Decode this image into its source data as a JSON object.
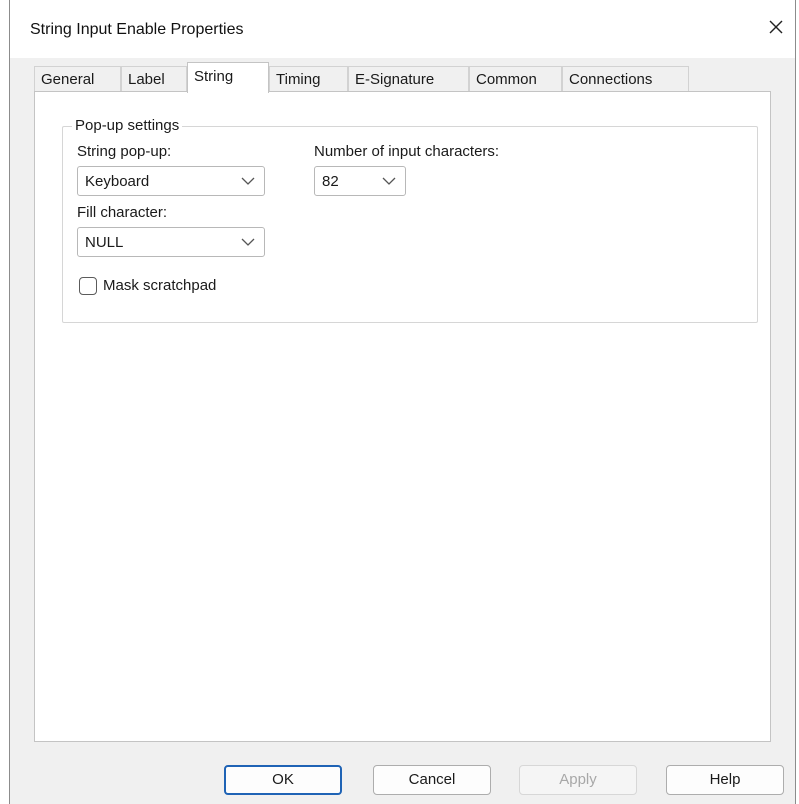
{
  "window": {
    "title": "String Input Enable Properties",
    "close_icon": "close-icon"
  },
  "tabs": [
    {
      "label": "General",
      "selected": false
    },
    {
      "label": "Label",
      "selected": false
    },
    {
      "label": "String",
      "selected": true
    },
    {
      "label": "Timing",
      "selected": false
    },
    {
      "label": "E-Signature",
      "selected": false
    },
    {
      "label": "Common",
      "selected": false
    },
    {
      "label": "Connections",
      "selected": false
    }
  ],
  "popup_settings": {
    "legend": "Pop-up settings",
    "string_popup": {
      "label": "String pop-up:",
      "value": "Keyboard"
    },
    "number_of_chars": {
      "label": "Number of input characters:",
      "value": "82"
    },
    "fill_character": {
      "label": "Fill character:",
      "value": "NULL"
    },
    "mask_scratchpad": {
      "label": "Mask scratchpad",
      "checked": false
    }
  },
  "buttons": {
    "ok": "OK",
    "cancel": "Cancel",
    "apply": "Apply",
    "help": "Help"
  },
  "colors": {
    "default_button_border": "#1f63b5",
    "disabled_text": "#a8a8a8",
    "dialog_background": "#f0f0f0"
  }
}
